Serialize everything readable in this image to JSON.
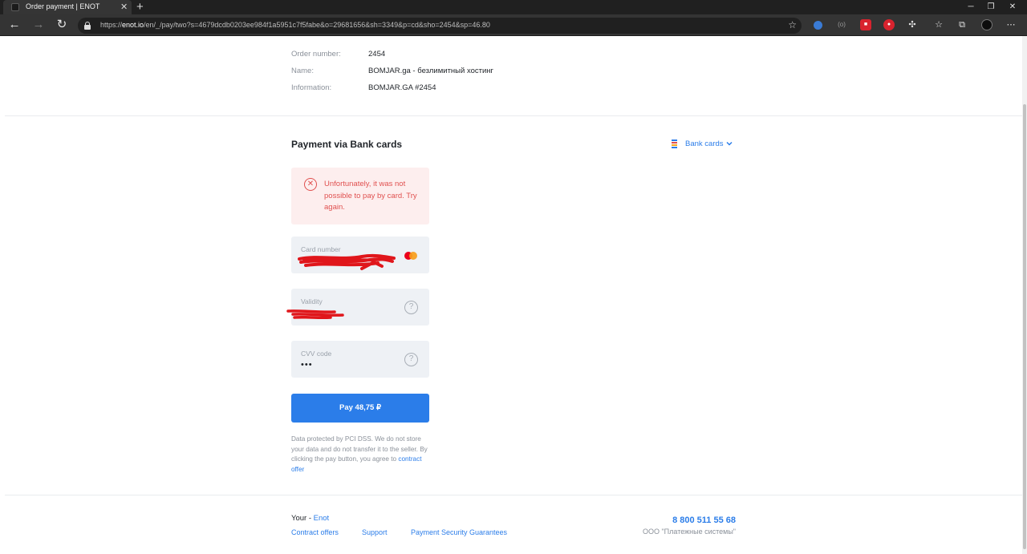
{
  "browser": {
    "tab_title": "Order payment | ENOT",
    "tab_close": "✕",
    "new_tab": "+",
    "url_prefix": "https://",
    "url_host": "enot.io",
    "url_path": "/en/_/pay/two?s=4679dcdb0203ee984f1a5951c7f5fabe&o=29681656&sh=3349&p=cd&sho=2454&sp=46.80"
  },
  "order": {
    "number_label": "Order number:",
    "number_value": "2454",
    "name_label": "Name:",
    "name_value": "BOMJAR.ga - безлимитный хостинг",
    "info_label": "Information:",
    "info_value": "BOMJAR.GA #2454"
  },
  "payment": {
    "title": "Payment via Bank cards",
    "method_label": "Bank cards",
    "error_message": "Unfortunately, it was not possible to pay by card. Try again.",
    "card_number_label": "Card number",
    "validity_label": "Validity",
    "cvv_label": "CVV code",
    "cvv_value": "•••",
    "pay_button_label": "Pay 48,75 ₽",
    "disclaimer_text": "Data protected by PCI DSS. We do not store your data and do not transfer it to the seller. By clicking the pay button, you agree to ",
    "contract_offer_link": "contract offer"
  },
  "footer": {
    "brand_prefix": "Your - ",
    "brand_link": "Enot",
    "contract_offers": "Contract offers",
    "support": "Support",
    "security": "Payment Security Guarantees",
    "phone": "8 800 511 55 68",
    "company": "ООО \"Платежные системы\""
  },
  "colors": {
    "accent": "#2b7de9",
    "error": "#e0504f",
    "error_bg": "#fdeeee",
    "field_bg": "#eef1f5",
    "redaction": "#e0161b"
  }
}
